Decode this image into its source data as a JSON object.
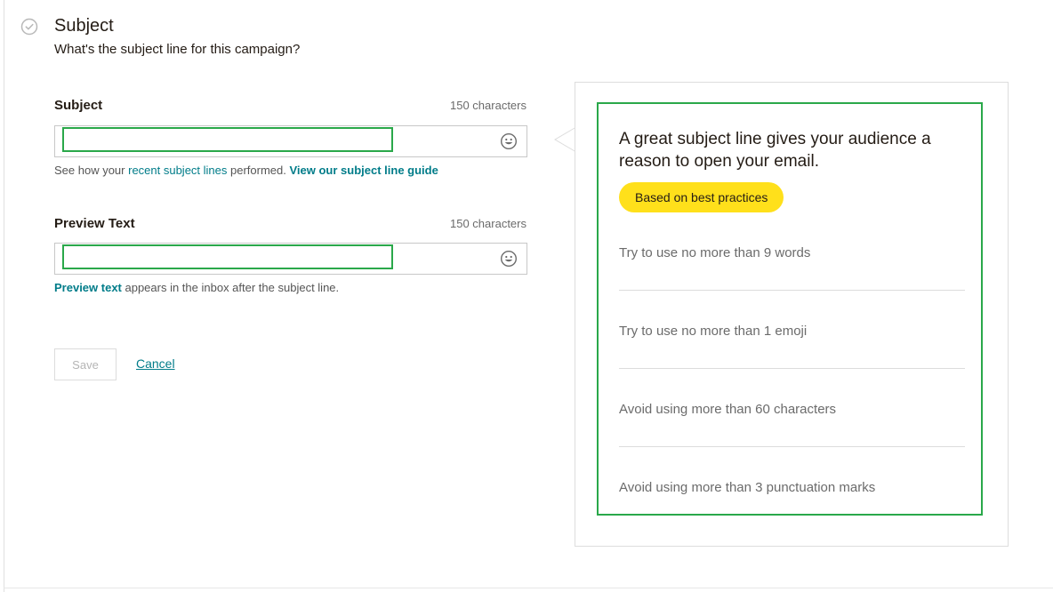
{
  "section": {
    "title": "Subject",
    "subtitle": "What's the subject line for this campaign?"
  },
  "subject_field": {
    "label": "Subject",
    "char_count": "150 characters",
    "value": "",
    "placeholder": "",
    "help_prefix": "See how your ",
    "help_link1": "recent subject lines",
    "help_middle": " performed. ",
    "help_link2": "View our subject line guide"
  },
  "preview_field": {
    "label": "Preview Text",
    "char_count": "150 characters",
    "value": "",
    "placeholder": "",
    "help_link": "Preview text",
    "help_suffix": " appears in the inbox after the subject line."
  },
  "actions": {
    "save_label": "Save",
    "cancel_label": "Cancel"
  },
  "tips": {
    "headline": "A great subject line gives your audience a reason to open your email.",
    "badge": "Based on best practices",
    "items": [
      "Try to use no more than 9 words",
      "Try to use no more than 1 emoji",
      "Avoid using more than 60 characters",
      "Avoid using more than 3 punctuation marks"
    ]
  },
  "colors": {
    "accent_green": "#2aa84a",
    "link_teal": "#007c89",
    "badge_yellow": "#ffe01b"
  },
  "icons": {
    "status": "check-circle-icon",
    "emoji": "smiley-icon"
  }
}
